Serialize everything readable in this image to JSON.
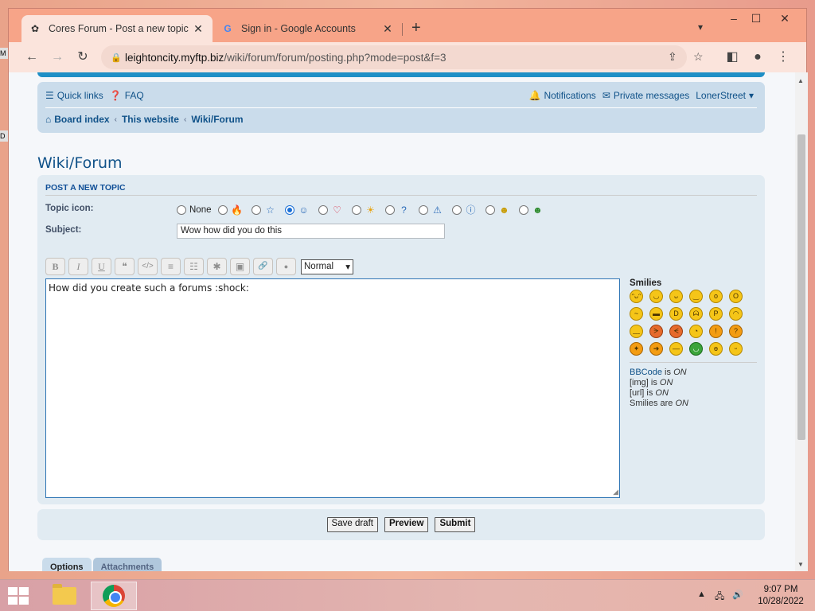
{
  "desktop": {
    "stub_top": "M",
    "stub_mid": "D"
  },
  "browser": {
    "tabs": [
      {
        "title": "Cores Forum - Post a new topic",
        "favicon": "globe-icon"
      },
      {
        "title": "Sign in - Google Accounts",
        "favicon": "google-icon"
      }
    ],
    "window_controls": {
      "minimize": "–",
      "maximize": "☐",
      "close": "✕"
    },
    "url_domain": "leightoncity.myftp.biz",
    "url_path": "/wiki/forum/forum/posting.php?mode=post&f=3"
  },
  "forum": {
    "quick_links": "Quick links",
    "faq": "FAQ",
    "notifications": "Notifications",
    "private_messages": "Private messages",
    "username": "LonerStreet",
    "breadcrumbs": [
      "Board index",
      "This website",
      "Wiki/Forum"
    ],
    "forum_title": "Wiki/Forum",
    "panel_title": "Post a new topic",
    "topic_icon_label": "Topic icon:",
    "topic_icon_none": "None",
    "subject_label": "Subject:",
    "subject_value": "Wow how did you do this",
    "toolbar": {
      "bold": "B",
      "italic": "I",
      "underline": "U",
      "quote": "❝",
      "code": "</>",
      "list": "≡",
      "list_numbered": "☷",
      "list_item": "✱",
      "image": "▣",
      "link": "🔗",
      "color": "●"
    },
    "font_size": "Normal",
    "message": "How did you create such a forums :shock:",
    "smilies_title": "Smilies",
    "bbcode_info": {
      "bbcode": "BBCode",
      "bbcode_is": "is",
      "on": "ON",
      "img": "[img]",
      "url": "[url]",
      "smilies": "Smilies are"
    },
    "buttons": {
      "save_draft": "Save draft",
      "preview": "Preview",
      "submit": "Submit"
    },
    "tabs": {
      "options": "Options",
      "attachments": "Attachments"
    }
  },
  "taskbar": {
    "time": "9:07 PM",
    "date": "10/28/2022"
  }
}
